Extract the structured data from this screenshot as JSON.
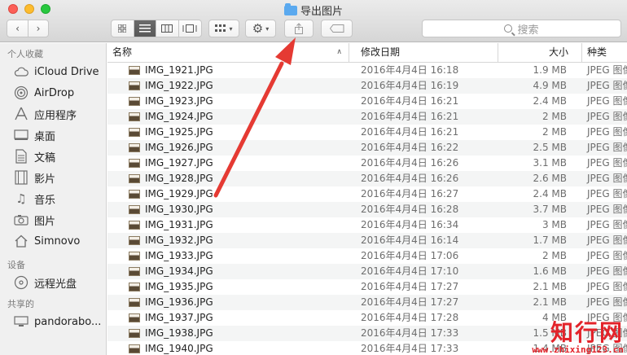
{
  "window": {
    "title": "导出图片"
  },
  "toolbar": {
    "back_icon": "chevron-left-icon",
    "forward_icon": "chevron-right-icon",
    "view_icons": [
      "icon-view-icon",
      "list-view-icon",
      "column-view-icon",
      "gallery-view-icon"
    ],
    "group_icon": "grid-group-icon",
    "action_icon": "gear-icon",
    "share_icon": "share-icon",
    "tag_icon": "tag-icon",
    "search_placeholder": "搜索"
  },
  "sidebar": {
    "sections": [
      {
        "heading": "个人收藏",
        "items": [
          {
            "label": "iCloud Drive",
            "icon": "cloud-icon"
          },
          {
            "label": "AirDrop",
            "icon": "airdrop-icon"
          },
          {
            "label": "应用程序",
            "icon": "applications-icon"
          },
          {
            "label": "桌面",
            "icon": "desktop-icon"
          },
          {
            "label": "文稿",
            "icon": "document-icon"
          },
          {
            "label": "影片",
            "icon": "film-icon"
          },
          {
            "label": "音乐",
            "icon": "music-icon"
          },
          {
            "label": "图片",
            "icon": "camera-icon"
          },
          {
            "label": "Simnovo",
            "icon": "home-icon"
          }
        ]
      },
      {
        "heading": "设备",
        "items": [
          {
            "label": "远程光盘",
            "icon": "disc-icon"
          }
        ]
      },
      {
        "heading": "共享的",
        "items": [
          {
            "label": "pandorabo...",
            "icon": "computer-icon"
          }
        ]
      }
    ]
  },
  "columns": {
    "name": "名称",
    "date": "修改日期",
    "size": "大小",
    "kind": "种类"
  },
  "files": [
    {
      "name": "IMG_1921.JPG",
      "date": "2016年4月4日 16:18",
      "size": "1.9 MB",
      "kind": "JPEG 图像"
    },
    {
      "name": "IMG_1922.JPG",
      "date": "2016年4月4日 16:19",
      "size": "4.9 MB",
      "kind": "JPEG 图像"
    },
    {
      "name": "IMG_1923.JPG",
      "date": "2016年4月4日 16:21",
      "size": "2.4 MB",
      "kind": "JPEG 图像"
    },
    {
      "name": "IMG_1924.JPG",
      "date": "2016年4月4日 16:21",
      "size": "2 MB",
      "kind": "JPEG 图像"
    },
    {
      "name": "IMG_1925.JPG",
      "date": "2016年4月4日 16:21",
      "size": "2 MB",
      "kind": "JPEG 图像"
    },
    {
      "name": "IMG_1926.JPG",
      "date": "2016年4月4日 16:22",
      "size": "2.5 MB",
      "kind": "JPEG 图像"
    },
    {
      "name": "IMG_1927.JPG",
      "date": "2016年4月4日 16:26",
      "size": "3.1 MB",
      "kind": "JPEG 图像"
    },
    {
      "name": "IMG_1928.JPG",
      "date": "2016年4月4日 16:26",
      "size": "2.6 MB",
      "kind": "JPEG 图像"
    },
    {
      "name": "IMG_1929.JPG",
      "date": "2016年4月4日 16:27",
      "size": "2.4 MB",
      "kind": "JPEG 图像"
    },
    {
      "name": "IMG_1930.JPG",
      "date": "2016年4月4日 16:28",
      "size": "3.7 MB",
      "kind": "JPEG 图像"
    },
    {
      "name": "IMG_1931.JPG",
      "date": "2016年4月4日 16:34",
      "size": "3 MB",
      "kind": "JPEG 图像"
    },
    {
      "name": "IMG_1932.JPG",
      "date": "2016年4月4日 16:14",
      "size": "1.7 MB",
      "kind": "JPEG 图像"
    },
    {
      "name": "IMG_1933.JPG",
      "date": "2016年4月4日 17:06",
      "size": "2 MB",
      "kind": "JPEG 图像"
    },
    {
      "name": "IMG_1934.JPG",
      "date": "2016年4月4日 17:10",
      "size": "1.6 MB",
      "kind": "JPEG 图像"
    },
    {
      "name": "IMG_1935.JPG",
      "date": "2016年4月4日 17:27",
      "size": "2.1 MB",
      "kind": "JPEG 图像"
    },
    {
      "name": "IMG_1936.JPG",
      "date": "2016年4月4日 17:27",
      "size": "2.1 MB",
      "kind": "JPEG 图像"
    },
    {
      "name": "IMG_1937.JPG",
      "date": "2016年4月4日 17:28",
      "size": "4 MB",
      "kind": "JPEG 图像"
    },
    {
      "name": "IMG_1938.JPG",
      "date": "2016年4月4日 17:33",
      "size": "1.5 MB",
      "kind": "JPEG 图像"
    },
    {
      "name": "IMG_1940.JPG",
      "date": "2016年4月4日 17:33",
      "size": "1.4 MB",
      "kind": "JPEG 图像"
    }
  ],
  "watermark": {
    "title": "知行网",
    "url": "www.zhixing123.cn"
  },
  "colors": {
    "arrow": "#e53a33",
    "watermark": "#e3232a",
    "row_alt": "#f4f5f5"
  }
}
